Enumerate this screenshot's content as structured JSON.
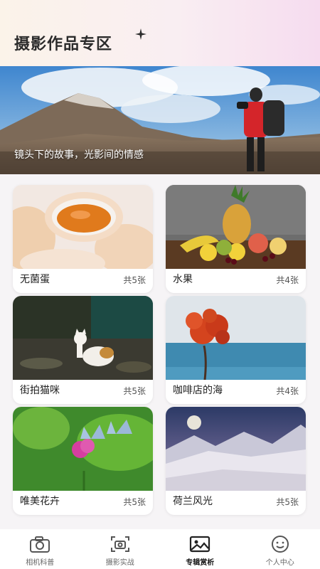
{
  "header": {
    "title": "摄影作品专区"
  },
  "banner": {
    "caption": "镜头下的故事，光影间的情感"
  },
  "albums": [
    {
      "name": "无菌蛋",
      "count": "共5张"
    },
    {
      "name": "水果",
      "count": "共4张"
    },
    {
      "name": "街拍猫咪",
      "count": "共5张"
    },
    {
      "name": "咖啡店的海",
      "count": "共4张"
    },
    {
      "name": "唯美花卉",
      "count": "共5张"
    },
    {
      "name": "荷兰风光",
      "count": "共5张"
    }
  ],
  "tabbar": {
    "items": [
      {
        "label": "相机科普",
        "icon": "camera-icon"
      },
      {
        "label": "摄影实战",
        "icon": "scan-camera-icon"
      },
      {
        "label": "专辑赏析",
        "icon": "image-icon",
        "active": true
      },
      {
        "label": "个人中心",
        "icon": "smile-face-icon"
      }
    ]
  }
}
